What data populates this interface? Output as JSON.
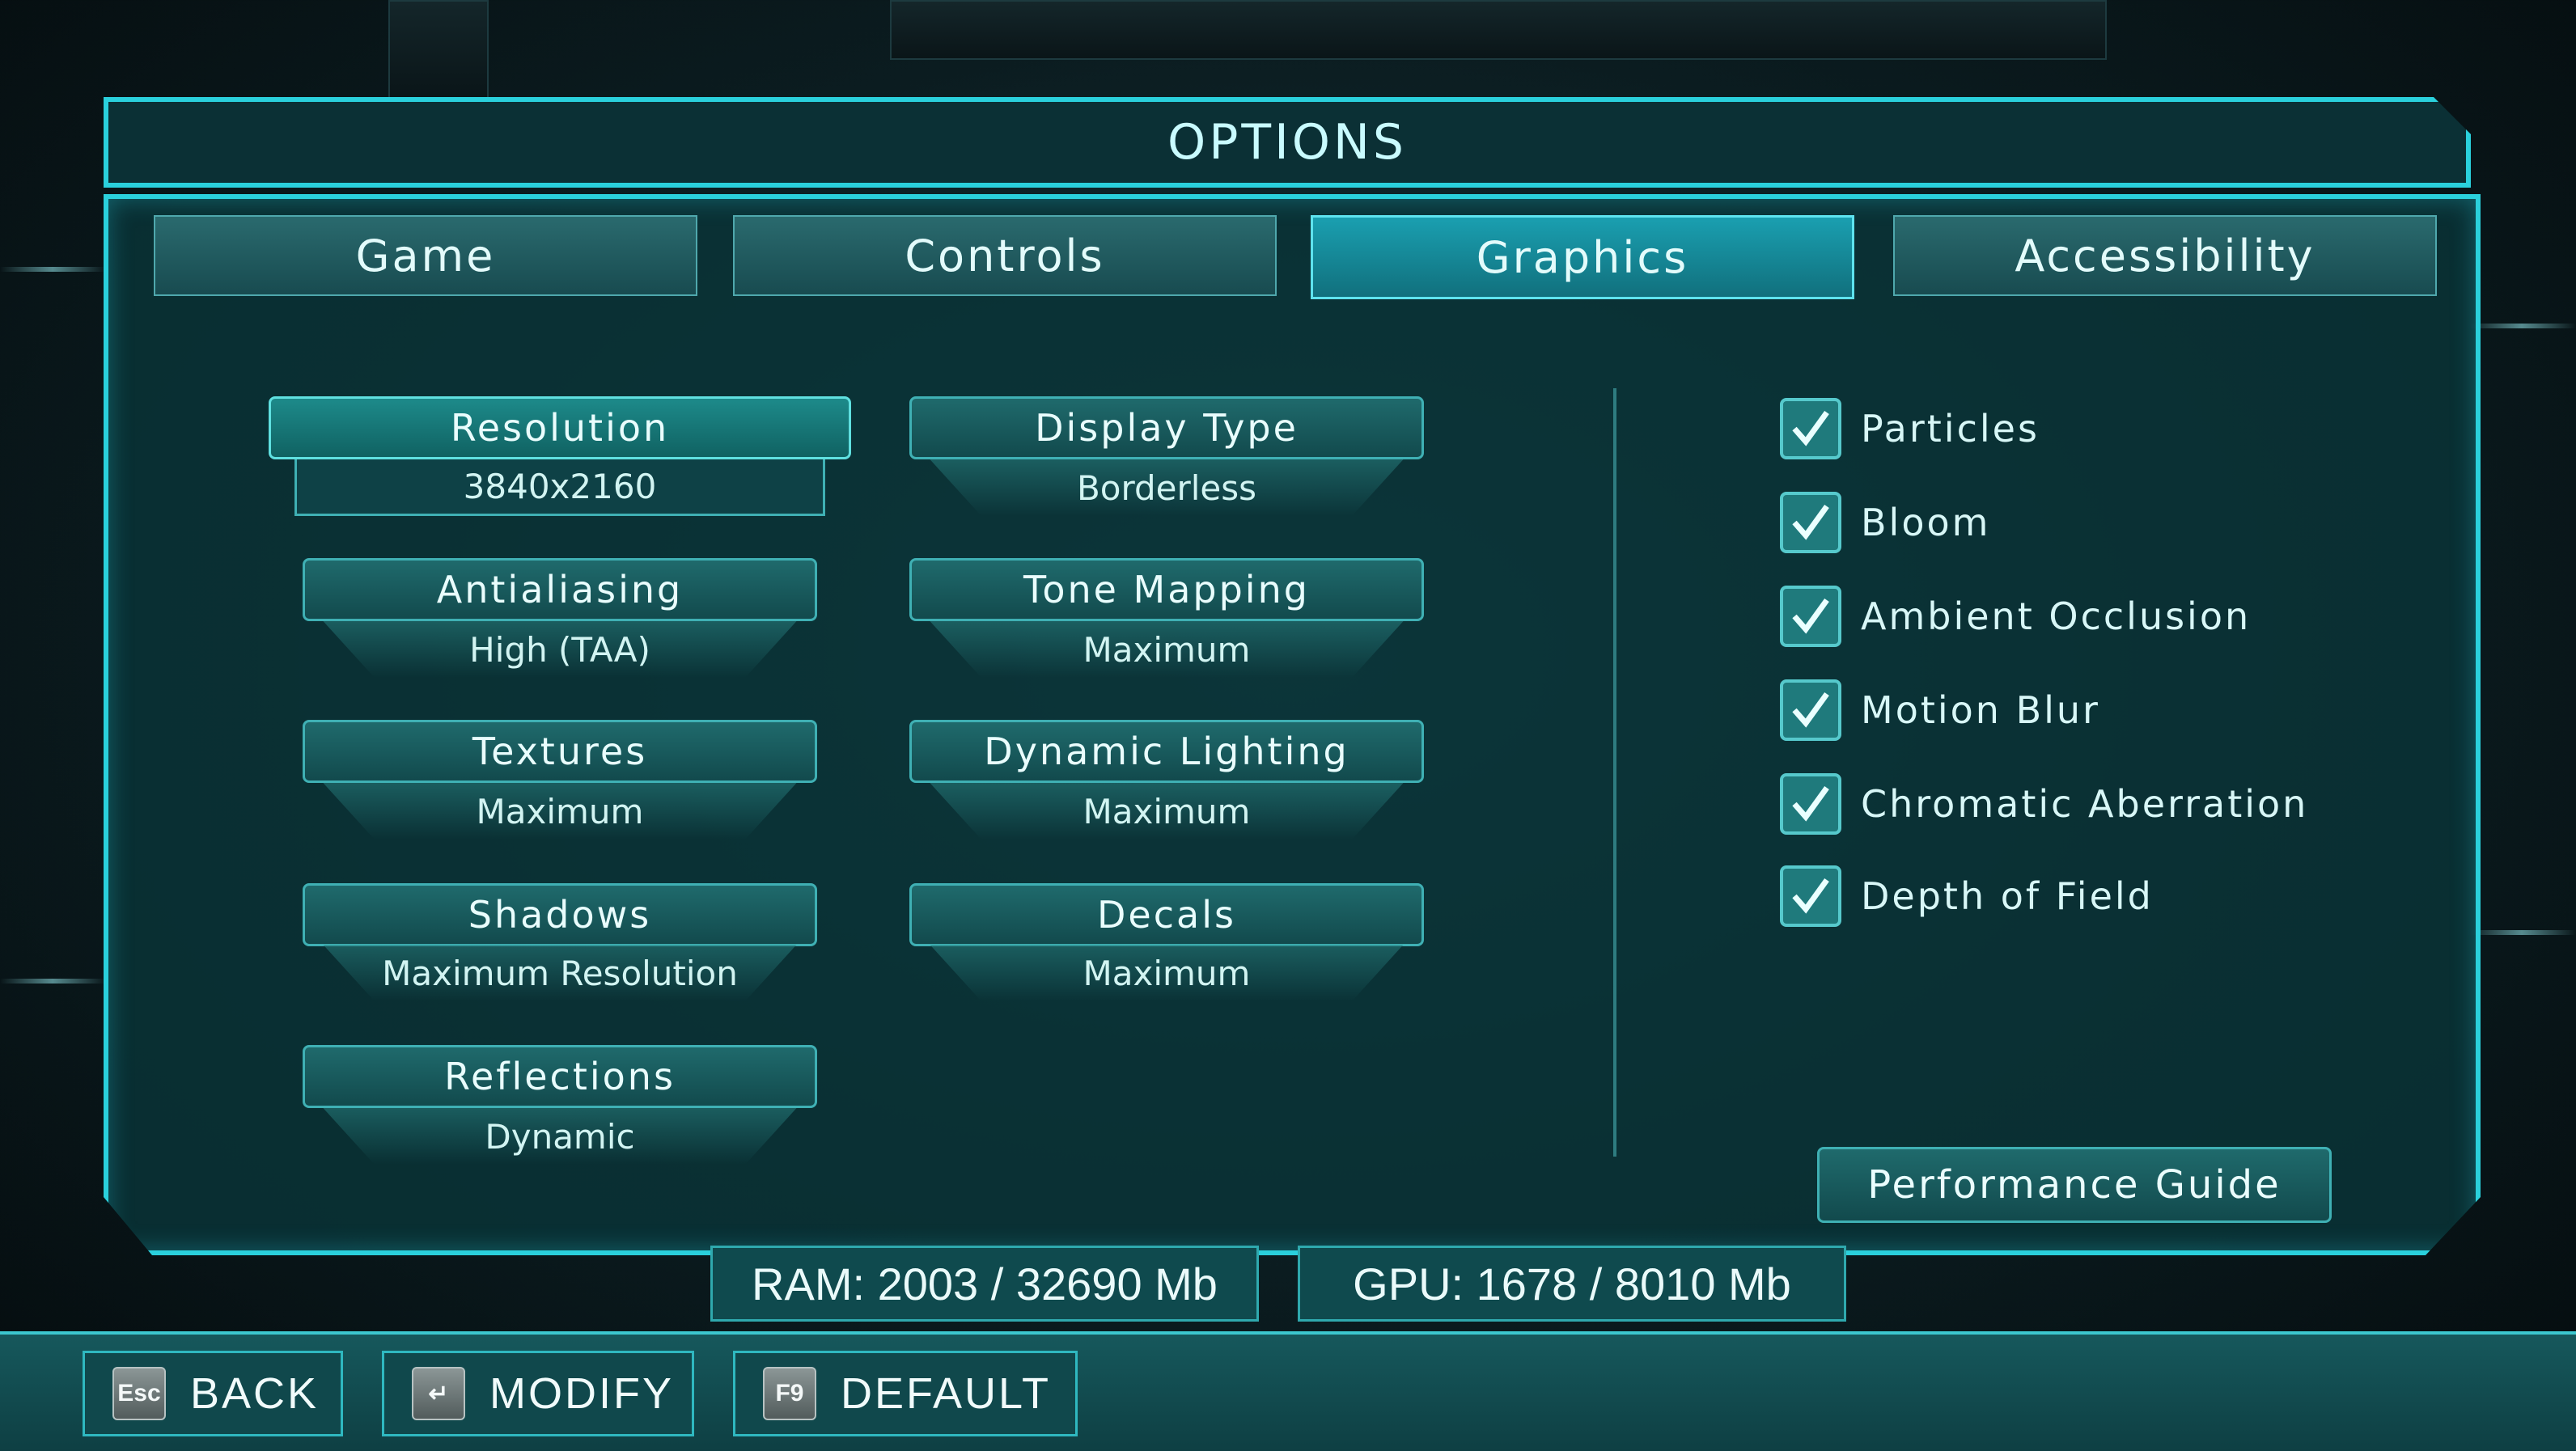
{
  "title": "OPTIONS",
  "tabs": [
    {
      "label": "Game"
    },
    {
      "label": "Controls"
    },
    {
      "label": "Graphics"
    },
    {
      "label": "Accessibility"
    }
  ],
  "active_tab": "Graphics",
  "settings": [
    {
      "label": "Resolution",
      "value": "3840x2160"
    },
    {
      "label": "Display Type",
      "value": "Borderless"
    },
    {
      "label": "Antialiasing",
      "value": "High (TAA)"
    },
    {
      "label": "Tone Mapping",
      "value": "Maximum"
    },
    {
      "label": "Textures",
      "value": "Maximum"
    },
    {
      "label": "Dynamic Lighting",
      "value": "Maximum"
    },
    {
      "label": "Shadows",
      "value": "Maximum Resolution"
    },
    {
      "label": "Decals",
      "value": "Maximum"
    },
    {
      "label": "Reflections",
      "value": "Dynamic"
    }
  ],
  "toggles": [
    {
      "label": "Particles",
      "checked": true
    },
    {
      "label": "Bloom",
      "checked": true
    },
    {
      "label": "Ambient Occlusion",
      "checked": true
    },
    {
      "label": "Motion Blur",
      "checked": true
    },
    {
      "label": "Chromatic Aberration",
      "checked": true
    },
    {
      "label": "Depth of Field",
      "checked": true
    }
  ],
  "performance_guide": "Performance Guide",
  "stats": {
    "ram": "RAM: 2003 / 32690 Mb",
    "gpu": "GPU: 1678 / 8010 Mb"
  },
  "hints": [
    {
      "key": "Esc",
      "label": "BACK"
    },
    {
      "key": "↵",
      "label": "MODIFY"
    },
    {
      "key": "F9",
      "label": "DEFAULT"
    }
  ],
  "colors": {
    "accent": "#2ad0dc",
    "panel": "#0a3438",
    "active_tab": "#1a9fb0"
  }
}
